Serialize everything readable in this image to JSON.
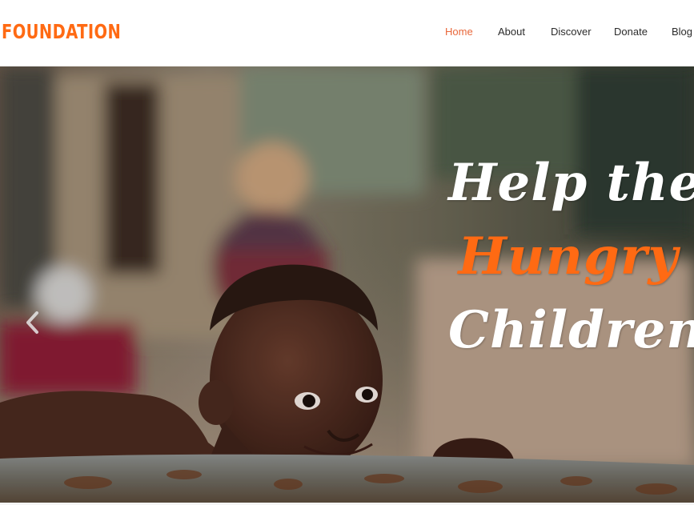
{
  "colors": {
    "brand": "#ff6a13",
    "nav_active": "#e8673a",
    "nav_text": "#2b2b2b",
    "headline_primary": "#ffffff",
    "headline_accent": "#ff6a13"
  },
  "header": {
    "logo": "FOUNDATION",
    "nav": [
      {
        "label": "Home",
        "active": true
      },
      {
        "label": "About",
        "active": false
      },
      {
        "label": "Discover",
        "active": false
      },
      {
        "label": "Donate",
        "active": false
      },
      {
        "label": "Blog",
        "active": false
      }
    ]
  },
  "hero": {
    "headline_line1": "Help the",
    "headline_line2": "Hungry",
    "headline_line3": "Children",
    "prev_icon": "chevron-left-icon"
  }
}
